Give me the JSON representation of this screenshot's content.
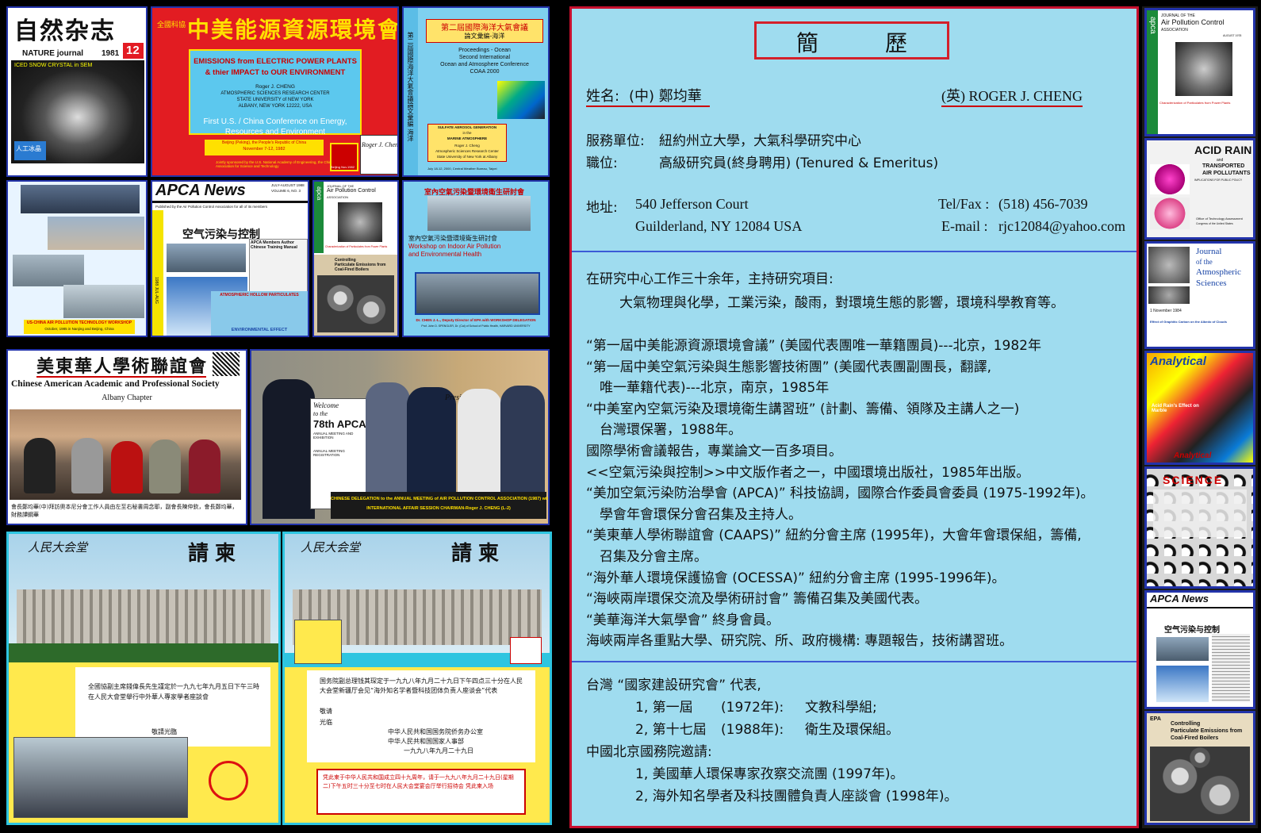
{
  "left": {
    "nature": {
      "title_cn": "自然杂志",
      "subtitle": "NATURE journal",
      "year": "1981",
      "issue": "12",
      "caption": "ICED SNOW CRYSTAL in SEM",
      "footer": "Atmospheric Sciences Research Center State University of New York at Albany",
      "inset": "人工冰晶"
    },
    "conference": {
      "title_cn": "中美能源資源環境會議",
      "side_cn": "全國科協",
      "box_line1": "EMISSIONS from ELECTRIC POWER PLANTS",
      "box_line2": "& thier IMPACT to OUR ENVIRONMENT",
      "author1": "Roger J. CHENG",
      "author2": "ATMOSPHERIC SCIENCES RESEARCH CENTER",
      "author3": "STATE UNIVERSITY of NEW YORK",
      "author4": "ALBANY, NEW YORK 12222, USA",
      "conf1": "First U.S. / China Conference on Energy,",
      "conf2": "Resources and Environment",
      "place1": "Beijing (Peking), the People's Republic of China",
      "place2": "November 7-12, 1982",
      "sponsor": "Jointly sponsored by the U.S. National Academy of Engineering, the China Association for Science and Technology",
      "signature": "Roger J. Chen",
      "badge": "Beijing Nov.1982"
    },
    "ocean": {
      "title_cn": "第二屆國際海洋大氣會議",
      "sub_cn": "論文彙編-海洋",
      "l1": "Proceedings - Ocean",
      "l2": "Second International",
      "l3": "Ocean and Atmosphere Conference",
      "l4": "COAA 2000",
      "paper1": "SULFATE AEROSOL GENERATION",
      "paper2": "in the",
      "paper3": "MARINE ATMOSPHERE",
      "paper4": "Roger J. Cheng",
      "paper5": "Atmospheric Sciences Research Center",
      "paper6": "State University of New York at Albany",
      "foot": "July 18-12, 2000, Central Weather Bureau, Taipei",
      "side": "第二屆國際海洋大氣會議論文彙編 海洋"
    },
    "workshop": {
      "caption1": "US-CHINA AIR POLLUTION TECHNOLOGY WORKSHOP",
      "caption2": "October, 1985 in Nanjing and Beijing, China"
    },
    "apca": {
      "brand": "APCA News",
      "date": "JULY-AUGUST 1988",
      "vol": "VOLUME 6, NO. 3",
      "pub": "Published by the Air Pollution Control Association for all of its members",
      "book_cn": "空气污染与控制",
      "member": "APCA Members Author Chinese Training Manual",
      "bottom1": "ATMOSPHERIC HOLLOW PARTICULATES",
      "bottom2": "ENVIRONMENTAL EFFECT",
      "side": "1988 JUL-AUG"
    },
    "japca": {
      "letters": "apca",
      "title1": "JOURNAL OF THE",
      "title2": "Air Pollution Control",
      "title3": "ASSOCIATION",
      "caption": "Characterization of Particulates from Power Plants",
      "controlling1": "Controlling",
      "controlling2": "Particulate Emissions from",
      "controlling3": "Coal-Fired Boilers"
    },
    "indoor": {
      "title_cn": "室內空氣污染暨環境衛生研討會",
      "l1_cn": "室內空氣污染暨環境衛生研討會",
      "l2": "Workshop on Indoor Air Pollution",
      "l3": "and Environmental Health",
      "caption1": "Dr. CHEN J.-L., Deputy Director of EPA with WORKSHOP DELEGATION",
      "caption2": "Prof. John D. SPENGLER, Dr. (Cai) of School of Public Health, HARVARD UNIVERSITY"
    },
    "caaps": {
      "title_cn": "美東華人學術聯誼會",
      "title_en": "Chinese American Academic and Professional Society",
      "chapter": "Albany Chapter",
      "caption_cn": "會長鄭均華(中)拜訪奧本尼分會工作人員由左至右秘書周念耶，副會長陳仲欽，會長鄭均華，財務譚鋼華"
    },
    "delegation": {
      "sign1": "Welcome",
      "sign2": "to the",
      "sign3": "78th APCA",
      "sign4": "ANNUAL MEETING AND EXHIBITION",
      "sign5": "ANNUAL MEETING REGISTRATION",
      "caption1": "CHINESE DELEGATION to the ANNUAL MEETING of AIR POLLUTION CONTROL ASSOCIATION (1987) with",
      "caption2": "INTERNATIONAL AFFAIR SESSION CHAIRMAN-Roger J. CHENG (L-2)",
      "presidents": "Presidents"
    },
    "invite_left": {
      "header_cn": "人民大会堂",
      "title_cn": "請柬",
      "body_cn": "全國協副主席錢偉長先生謹定於一九九七年九月五日下午三時在人民大會堂舉行中外華人專家學者座談會",
      "sign_cn": "敬請光臨"
    },
    "invite_right": {
      "header_cn": "人民大会堂",
      "title_cn": "請柬",
      "body_cn": "国务院副总理钱其琛定于一九九八年九月二十九日下午四点三十分在人民大会堂新疆厅会见“海外知名学者暨科技团体负责人座谈会”代表",
      "sign1": "敬请",
      "sign2": "光临",
      "org1": "中华人民共和国国务院侨务办公室",
      "org2": "中华人民共和国国家人事部",
      "date": "一九九八年九月二十九日",
      "note_cn": "凭此柬于中华人民共和国成立四十九周年，请于一九九八年九月二十九日(星期二)下午五时三十分至七时在人民大会堂宴会厅举行招待会 凭此柬入场"
    }
  },
  "resume": {
    "title": "簡　　　歷",
    "name_label": "姓名:",
    "name_cn": "(中) 鄭均華",
    "name_en": "(英) ROGER J. CHENG",
    "unit_label": "服務單位:",
    "unit_value": "紐約州立大學，大氣科學研究中心",
    "title_label": "職位:",
    "title_value": "高級研究員(終身聘用) (Tenured & Emeritus)",
    "addr_label": "地址:",
    "addr1": "540  Jefferson Court",
    "addr2": "Guilderland, NY  12084 USA",
    "tel_label": "Tel/Fax :",
    "tel_value": "(518)  456-7039",
    "email_label": "E-mail :",
    "email_value": "rjc12084@yahoo.com",
    "research_intro": "在研究中心工作三十余年，主持研究項目:",
    "research_items": "大氣物理與化學，工業污染，酸雨，對環境生態的影響，環境科學教育等。",
    "activities": [
      "“第一屆中美能源資源環境會議” (美國代表團唯一華籍團員)---北京，1982年",
      "“第一屆中美空氣污染與生態影響技術團” (美國代表團副團長，翻譯,",
      "　唯一華籍代表)---北京，南京，1985年",
      "“中美室內空氣污染及環境衛生講習班” (計劃、籌備、領隊及主講人之一)",
      "　台灣環保署，1988年。",
      "國際學術會議報告，專業論文一百多項目。",
      "<<空氣污染與控制>>中文版作者之一，中國環境出版社，1985年出版。",
      "“美加空氣污染防治學會 (APCA)” 科技協調，國際合作委員會委員 (1975-1992年)。",
      "　學會年會環保分會召集及主持人。",
      "“美東華人學術聯誼會 (CAAPS)” 紐約分會主席 (1995年)，大會年會環保組，籌備,",
      "　召集及分會主席。",
      "“海外華人環境保護協會 (OCESSA)” 紐約分會主席 (1995-1996年)。",
      "“海峽兩岸環保交流及學術研討會” 籌備召集及美國代表。",
      "“美華海洋大氣學會” 終身會員。",
      "海峽兩岸各重點大學、研究院、所、政府機構:  專題報告，技術講習班。"
    ],
    "taiwan_label": "台灣 “國家建設研究會” 代表,",
    "taiwan1_num": "1, 第一屆",
    "taiwan1_year": "(1972年):",
    "taiwan1_group": "文教科學組;",
    "taiwan2_num": "2, 第十七屆",
    "taiwan2_year": "(1988年):",
    "taiwan2_group": "衛生及環保組。",
    "beijing_label": "中國北京國務院邀請:",
    "beijing1": "1, 美國華人環保專家孜察交流團 (1997年)。",
    "beijing2": "2, 海外知名學者及科技團體負責人座談會 (1998年)。"
  },
  "strip": {
    "c1": {
      "letters": "apca",
      "l1": "JOURNAL OF THE",
      "l2": "Air Pollution Control",
      "l3": "ASSOCIATION",
      "date": "AUGUST 1978",
      "caption": "Characterization of Particulates from Power Plants"
    },
    "c2": {
      "l1": "ACID RAIN",
      "l2": "and",
      "l3": "TRANSPORTED",
      "l4": "AIR POLLUTANTS",
      "l5": "IMPLICATIONS FOR PUBLIC POLICY",
      "foot": "Office of Technology Assessment",
      "foot2": "Congress of the United States"
    },
    "c3": {
      "l1": "Journal",
      "l2": "of the",
      "l3": "Atmospheric",
      "l4": "Sciences",
      "date": "1 November 1984",
      "caption": "Effect of Graphitic Carbon on the Albedo of Clouds"
    },
    "c4": {
      "title": "Analytical",
      "sub": "Acid Rain's Effect on Marble",
      "foot": "Analytical"
    },
    "c5": {
      "title": "SCIENCE"
    },
    "c6": {
      "brand": "APCA News",
      "book_cn": "空气污染与控制"
    },
    "c7": {
      "l1": "Controlling",
      "l2": "Particulate Emissions from",
      "l3": "Coal-Fired Boilers",
      "brand": "EPA"
    }
  }
}
